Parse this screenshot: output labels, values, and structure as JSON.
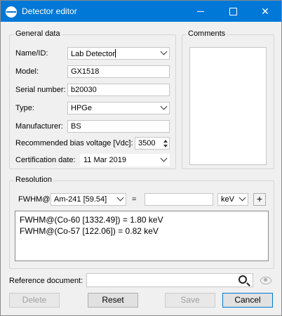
{
  "window": {
    "title": "Detector editor"
  },
  "general": {
    "title": "General data",
    "name_label": "Name/ID:",
    "name_value": "Lab Detector",
    "model_label": "Model:",
    "model_value": "GX1518",
    "serial_label": "Serial number:",
    "serial_value": "b20030",
    "type_label": "Type:",
    "type_value": "HPGe",
    "manufacturer_label": "Manufacturer:",
    "manufacturer_value": "BS",
    "bias_label": "Recommended bias voltage [Vdc]:",
    "bias_value": "3500",
    "cert_label": "Certification date:",
    "cert_value": "11 Mar 2019"
  },
  "comments": {
    "title": "Comments",
    "value": ""
  },
  "resolution": {
    "title": "Resolution",
    "fwhm_label": "FWHM@",
    "nuclide_value": "Am-241 [59.54]",
    "equals": "=",
    "fwhm_input": "",
    "unit_value": "keV",
    "add_label": "+",
    "results": [
      "FWHM@(Co-60 [1332.49]) = 1.80 keV",
      "FWHM@(Co-57 [122.06]) = 0.82 keV"
    ]
  },
  "reference": {
    "label": "Reference document:",
    "value": ""
  },
  "buttons": {
    "delete": "Delete",
    "reset": "Reset",
    "save": "Save",
    "cancel": "Cancel"
  },
  "icons": {
    "app": "detector-app-icon",
    "search": "search-icon",
    "view": "eye-icon"
  }
}
